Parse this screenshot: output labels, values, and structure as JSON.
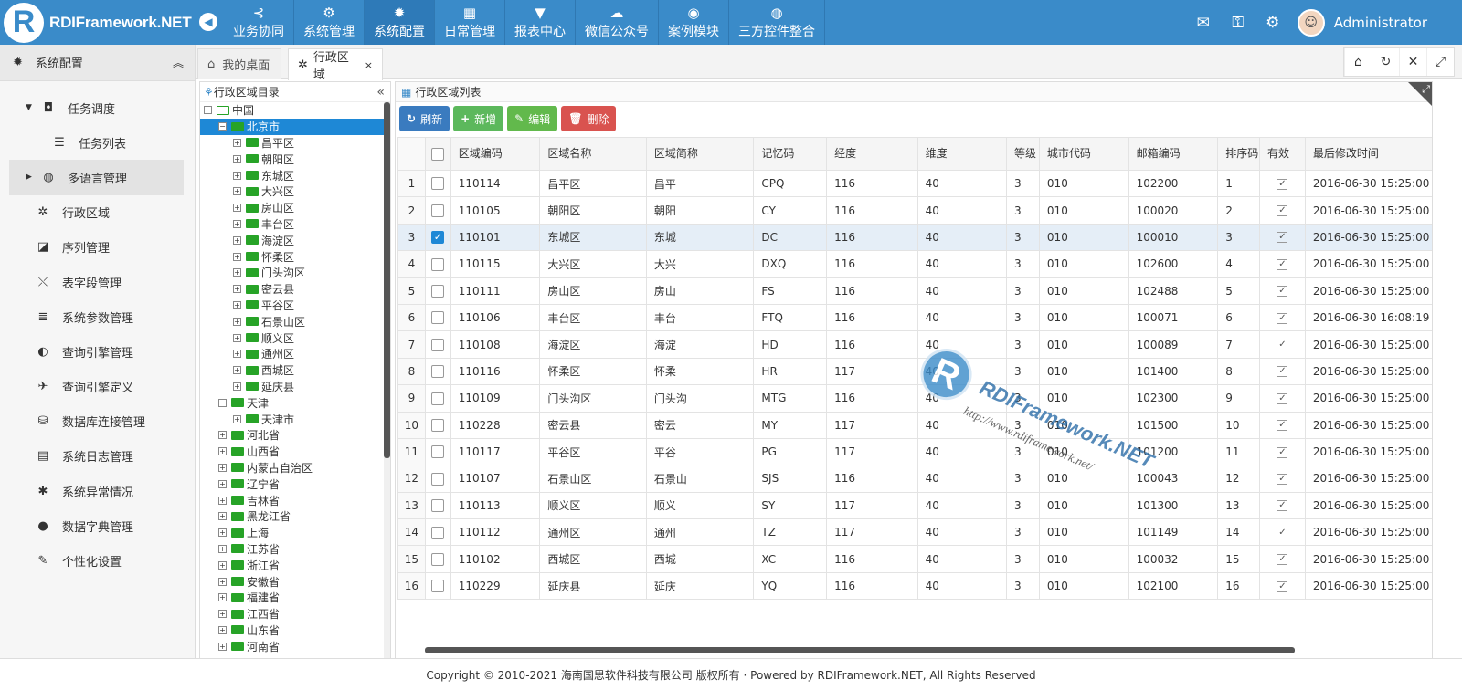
{
  "brand": {
    "logo_letter": "R",
    "name": "RDIFramework.NET"
  },
  "topnav": {
    "collapse_glyph": "◀",
    "items": [
      {
        "label": "业务协同",
        "icon": "share-icon",
        "glyph": "⊰"
      },
      {
        "label": "系统管理",
        "icon": "gears-icon",
        "glyph": "⚙"
      },
      {
        "label": "系统配置",
        "icon": "gear-icon",
        "glyph": "✹"
      },
      {
        "label": "日常管理",
        "icon": "calendar-icon",
        "glyph": "▦"
      },
      {
        "label": "报表中心",
        "icon": "filter-icon",
        "glyph": "▼"
      },
      {
        "label": "微信公众号",
        "icon": "wechat-icon",
        "glyph": "☁"
      },
      {
        "label": "案例模块",
        "icon": "eye-icon",
        "glyph": "◉"
      },
      {
        "label": "三方控件整合",
        "icon": "globe-icon",
        "glyph": "◍"
      }
    ],
    "active_index": 2,
    "right_icons": [
      {
        "name": "mail-icon",
        "glyph": "✉"
      },
      {
        "name": "key-icon",
        "glyph": "⚿"
      },
      {
        "name": "settings-icon",
        "glyph": "⚙"
      }
    ],
    "avatar_glyph": "☺",
    "user": "Administrator"
  },
  "sidebar": {
    "title": "系统配置",
    "title_glyph": "✹",
    "collapse_glyph": "︽",
    "items": [
      {
        "label": "任务调度",
        "arrow": "▼",
        "glyph": "◘",
        "icon": "task-icon",
        "kind": "parent"
      },
      {
        "label": "任务列表",
        "arrow": "",
        "glyph": "☰",
        "icon": "list-icon",
        "kind": "sub"
      },
      {
        "label": "多语言管理",
        "arrow": "▶",
        "glyph": "◍",
        "icon": "globe-icon",
        "kind": "hl"
      },
      {
        "label": "行政区域",
        "arrow": "",
        "glyph": "✲",
        "icon": "region-icon",
        "kind": "plain"
      },
      {
        "label": "序列管理",
        "arrow": "",
        "glyph": "◪",
        "icon": "sequence-icon",
        "kind": "plain"
      },
      {
        "label": "表字段管理",
        "arrow": "",
        "glyph": "⤬",
        "icon": "field-icon",
        "kind": "plain"
      },
      {
        "label": "系统参数管理",
        "arrow": "",
        "glyph": "≣",
        "icon": "params-icon",
        "kind": "plain"
      },
      {
        "label": "查询引擎管理",
        "arrow": "",
        "glyph": "◐",
        "icon": "query-engine-icon",
        "kind": "plain"
      },
      {
        "label": "查询引擎定义",
        "arrow": "",
        "glyph": "✈",
        "icon": "query-define-icon",
        "kind": "plain"
      },
      {
        "label": "数据库连接管理",
        "arrow": "",
        "glyph": "⛁",
        "icon": "database-icon",
        "kind": "plain"
      },
      {
        "label": "系统日志管理",
        "arrow": "",
        "glyph": "▤",
        "icon": "log-icon",
        "kind": "plain"
      },
      {
        "label": "系统异常情况",
        "arrow": "",
        "glyph": "✱",
        "icon": "bug-icon",
        "kind": "plain"
      },
      {
        "label": "数据字典管理",
        "arrow": "",
        "glyph": "●",
        "icon": "dictionary-icon",
        "kind": "plain"
      },
      {
        "label": "个性化设置",
        "arrow": "",
        "glyph": "✎",
        "icon": "wrench-icon",
        "kind": "plain"
      }
    ]
  },
  "tabs": [
    {
      "label": "我的桌面",
      "glyph": "⌂",
      "closable": false
    },
    {
      "label": "行政区域",
      "glyph": "✲",
      "closable": true,
      "close": "×"
    }
  ],
  "tabtools": [
    {
      "name": "home-icon",
      "glyph": "⌂"
    },
    {
      "name": "refresh-icon",
      "glyph": "↻"
    },
    {
      "name": "close-all-icon",
      "glyph": "✕"
    },
    {
      "name": "fullscreen-icon",
      "glyph": "⤢"
    }
  ],
  "tree": {
    "title": "行政区域目录",
    "title_glyph": "⚘",
    "collapse_glyph": "«",
    "nodes": [
      {
        "label": "中国",
        "level": 0,
        "pm": "−"
      },
      {
        "label": "北京市",
        "level": 1,
        "pm": "−",
        "selected": true
      },
      {
        "label": "昌平区",
        "level": 2,
        "pm": "+"
      },
      {
        "label": "朝阳区",
        "level": 2,
        "pm": "+"
      },
      {
        "label": "东城区",
        "level": 2,
        "pm": "+"
      },
      {
        "label": "大兴区",
        "level": 2,
        "pm": "+"
      },
      {
        "label": "房山区",
        "level": 2,
        "pm": "+"
      },
      {
        "label": "丰台区",
        "level": 2,
        "pm": "+"
      },
      {
        "label": "海淀区",
        "level": 2,
        "pm": "+"
      },
      {
        "label": "怀柔区",
        "level": 2,
        "pm": "+"
      },
      {
        "label": "门头沟区",
        "level": 2,
        "pm": "+"
      },
      {
        "label": "密云县",
        "level": 2,
        "pm": "+"
      },
      {
        "label": "平谷区",
        "level": 2,
        "pm": "+"
      },
      {
        "label": "石景山区",
        "level": 2,
        "pm": "+"
      },
      {
        "label": "顺义区",
        "level": 2,
        "pm": "+"
      },
      {
        "label": "通州区",
        "level": 2,
        "pm": "+"
      },
      {
        "label": "西城区",
        "level": 2,
        "pm": "+"
      },
      {
        "label": "延庆县",
        "level": 2,
        "pm": "+"
      },
      {
        "label": "天津",
        "level": 1,
        "pm": "−"
      },
      {
        "label": "天津市",
        "level": 2,
        "pm": "+"
      },
      {
        "label": "河北省",
        "level": 1,
        "pm": "+"
      },
      {
        "label": "山西省",
        "level": 1,
        "pm": "+"
      },
      {
        "label": "内蒙古自治区",
        "level": 1,
        "pm": "+"
      },
      {
        "label": "辽宁省",
        "level": 1,
        "pm": "+"
      },
      {
        "label": "吉林省",
        "level": 1,
        "pm": "+"
      },
      {
        "label": "黑龙江省",
        "level": 1,
        "pm": "+"
      },
      {
        "label": "上海",
        "level": 1,
        "pm": "+"
      },
      {
        "label": "江苏省",
        "level": 1,
        "pm": "+"
      },
      {
        "label": "浙江省",
        "level": 1,
        "pm": "+"
      },
      {
        "label": "安徽省",
        "level": 1,
        "pm": "+"
      },
      {
        "label": "福建省",
        "level": 1,
        "pm": "+"
      },
      {
        "label": "江西省",
        "level": 1,
        "pm": "+"
      },
      {
        "label": "山东省",
        "level": 1,
        "pm": "+"
      },
      {
        "label": "河南省",
        "level": 1,
        "pm": "+"
      }
    ]
  },
  "grid": {
    "title": "行政区域列表",
    "title_glyph": "▦",
    "corner_glyph": "⤢",
    "buttons": [
      {
        "label": "刷新",
        "glyph": "↻",
        "cls": "b-blue",
        "name": "refresh-button"
      },
      {
        "label": "新增",
        "glyph": "+",
        "cls": "b-green",
        "name": "add-button"
      },
      {
        "label": "编辑",
        "glyph": "✎",
        "cls": "b-green2",
        "name": "edit-button"
      },
      {
        "label": "删除",
        "glyph": "🗑",
        "cls": "b-red",
        "name": "delete-button"
      }
    ],
    "columns": [
      "区域编码",
      "区域名称",
      "区域简称",
      "记忆码",
      "经度",
      "维度",
      "等级",
      "城市代码",
      "邮箱编码",
      "排序码",
      "有效",
      "最后修改时间"
    ],
    "check_glyph": "✓",
    "rows": [
      {
        "n": "1",
        "checked": false,
        "cells": [
          "110114",
          "昌平区",
          "昌平",
          "CPQ",
          "116",
          "40",
          "3",
          "010",
          "102200",
          "1",
          "✓",
          "2016-06-30 15:25:00"
        ]
      },
      {
        "n": "2",
        "checked": false,
        "cells": [
          "110105",
          "朝阳区",
          "朝阳",
          "CY",
          "116",
          "40",
          "3",
          "010",
          "100020",
          "2",
          "✓",
          "2016-06-30 15:25:00"
        ]
      },
      {
        "n": "3",
        "checked": true,
        "cells": [
          "110101",
          "东城区",
          "东城",
          "DC",
          "116",
          "40",
          "3",
          "010",
          "100010",
          "3",
          "✓",
          "2016-06-30 15:25:00"
        ]
      },
      {
        "n": "4",
        "checked": false,
        "cells": [
          "110115",
          "大兴区",
          "大兴",
          "DXQ",
          "116",
          "40",
          "3",
          "010",
          "102600",
          "4",
          "✓",
          "2016-06-30 15:25:00"
        ]
      },
      {
        "n": "5",
        "checked": false,
        "cells": [
          "110111",
          "房山区",
          "房山",
          "FS",
          "116",
          "40",
          "3",
          "010",
          "102488",
          "5",
          "✓",
          "2016-06-30 15:25:00"
        ]
      },
      {
        "n": "6",
        "checked": false,
        "cells": [
          "110106",
          "丰台区",
          "丰台",
          "FTQ",
          "116",
          "40",
          "3",
          "010",
          "100071",
          "6",
          "✓",
          "2016-06-30 16:08:19"
        ]
      },
      {
        "n": "7",
        "checked": false,
        "cells": [
          "110108",
          "海淀区",
          "海淀",
          "HD",
          "116",
          "40",
          "3",
          "010",
          "100089",
          "7",
          "✓",
          "2016-06-30 15:25:00"
        ]
      },
      {
        "n": "8",
        "checked": false,
        "cells": [
          "110116",
          "怀柔区",
          "怀柔",
          "HR",
          "117",
          "40",
          "3",
          "010",
          "101400",
          "8",
          "✓",
          "2016-06-30 15:25:00"
        ]
      },
      {
        "n": "9",
        "checked": false,
        "cells": [
          "110109",
          "门头沟区",
          "门头沟",
          "MTG",
          "116",
          "40",
          "3",
          "010",
          "102300",
          "9",
          "✓",
          "2016-06-30 15:25:00"
        ]
      },
      {
        "n": "10",
        "checked": false,
        "cells": [
          "110228",
          "密云县",
          "密云",
          "MY",
          "117",
          "40",
          "3",
          "010",
          "101500",
          "10",
          "✓",
          "2016-06-30 15:25:00"
        ]
      },
      {
        "n": "11",
        "checked": false,
        "cells": [
          "110117",
          "平谷区",
          "平谷",
          "PG",
          "117",
          "40",
          "3",
          "010",
          "101200",
          "11",
          "✓",
          "2016-06-30 15:25:00"
        ]
      },
      {
        "n": "12",
        "checked": false,
        "cells": [
          "110107",
          "石景山区",
          "石景山",
          "SJS",
          "116",
          "40",
          "3",
          "010",
          "100043",
          "12",
          "✓",
          "2016-06-30 15:25:00"
        ]
      },
      {
        "n": "13",
        "checked": false,
        "cells": [
          "110113",
          "顺义区",
          "顺义",
          "SY",
          "117",
          "40",
          "3",
          "010",
          "101300",
          "13",
          "✓",
          "2016-06-30 15:25:00"
        ]
      },
      {
        "n": "14",
        "checked": false,
        "cells": [
          "110112",
          "通州区",
          "通州",
          "TZ",
          "117",
          "40",
          "3",
          "010",
          "101149",
          "14",
          "✓",
          "2016-06-30 15:25:00"
        ]
      },
      {
        "n": "15",
        "checked": false,
        "cells": [
          "110102",
          "西城区",
          "西城",
          "XC",
          "116",
          "40",
          "3",
          "010",
          "100032",
          "15",
          "✓",
          "2016-06-30 15:25:00"
        ]
      },
      {
        "n": "16",
        "checked": false,
        "cells": [
          "110229",
          "延庆县",
          "延庆",
          "YQ",
          "116",
          "40",
          "3",
          "010",
          "102100",
          "16",
          "✓",
          "2016-06-30 15:25:00"
        ]
      }
    ]
  },
  "watermark": {
    "letter": "R",
    "title": "RDIFramework.NET",
    "url": "http://www.rdiframework.net/"
  },
  "footer": "Copyright © 2010-2021 海南国思软件科技有限公司 版权所有 · Powered by RDIFramework.NET, All Rights Reserved",
  "colors": {
    "primary": "#3a8bc9",
    "selected": "#1e88d6",
    "folder": "#27a327",
    "danger": "#d9534f",
    "success": "#5cb85c"
  }
}
